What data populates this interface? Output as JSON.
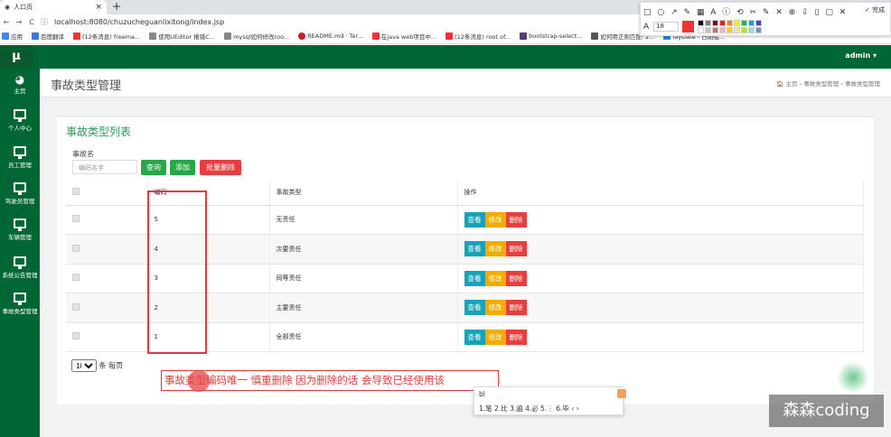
{
  "browser": {
    "tab_title": "人口页",
    "url": "localhost:8080/chuzucheguanlixitong/index.jsp",
    "bookmarks": [
      "应用",
      "百度翻译",
      "(12条消息) freema...",
      "使用UEditor 报错C...",
      "mysql如何修改roo...",
      "README.md · Ter...",
      "在java web项目中...",
      "(12条消息) root of...",
      "bootstrap-select...",
      "如何用正则匹配: 2...",
      "layDate - 日期组..."
    ]
  },
  "annotation_toolbar": {
    "tools": "□ ○ ↗ ✎ ▦ A ⓘ ⟲ ✂ ✎ ✕ ⊕ ⇩ ▯ ▢ ✕",
    "done_label": "✓ 完成",
    "font_size": "18",
    "current_color": "#f03333",
    "palette": [
      "#000000",
      "#7f7f7f",
      "#880015",
      "#ed1c24",
      "#ff7f27",
      "#fff200",
      "#22b14c",
      "#00a2e8",
      "#3f48cc",
      "#ffffff",
      "#c3c3c3",
      "#b97a57",
      "#ffaec9",
      "#ffc90e",
      "#efe4b0",
      "#b5e61d",
      "#99d9ea",
      "#7092be"
    ]
  },
  "header": {
    "logo": "μ",
    "user_menu": "admin ▾"
  },
  "sidebar": {
    "items": [
      {
        "label": "主页"
      },
      {
        "label": "个人中心"
      },
      {
        "label": "员工管理"
      },
      {
        "label": "驾驶员管理"
      },
      {
        "label": "车辆管理"
      },
      {
        "label": "系统公告管理"
      },
      {
        "label": "事故类型管理"
      }
    ]
  },
  "page": {
    "title": "事故类型管理",
    "breadcrumb": "🏠 主页 › 事故类型管理 › 事故类型管理"
  },
  "list": {
    "title": "事故类型列表",
    "filter_label": "事故名",
    "filter_placeholder": "编码名字",
    "query_button": "查询",
    "add_button": "添加",
    "batch_delete_button": "批量删除",
    "columns": [
      "",
      "编码",
      "事故类型",
      "操作"
    ],
    "rows": [
      {
        "code": "5",
        "type": "无责任"
      },
      {
        "code": "4",
        "type": "次要责任"
      },
      {
        "code": "3",
        "type": "同等责任"
      },
      {
        "code": "2",
        "type": "主要责任"
      },
      {
        "code": "1",
        "type": "全部责任"
      }
    ],
    "action_view": "查看",
    "action_edit": "修改",
    "action_delete": "删除",
    "page_size": "10",
    "page_size_suffix": "条 每页"
  },
  "annotation_note": "事故类型编码唯一 慎重删除 因为删除的话 会导致已经使用该",
  "ime": {
    "input": "bl",
    "candidates": "1.笔 2.比 3.遍 4.必 5.⋮ 6.毕 ‹ ›"
  },
  "watermark": "森森coding"
}
